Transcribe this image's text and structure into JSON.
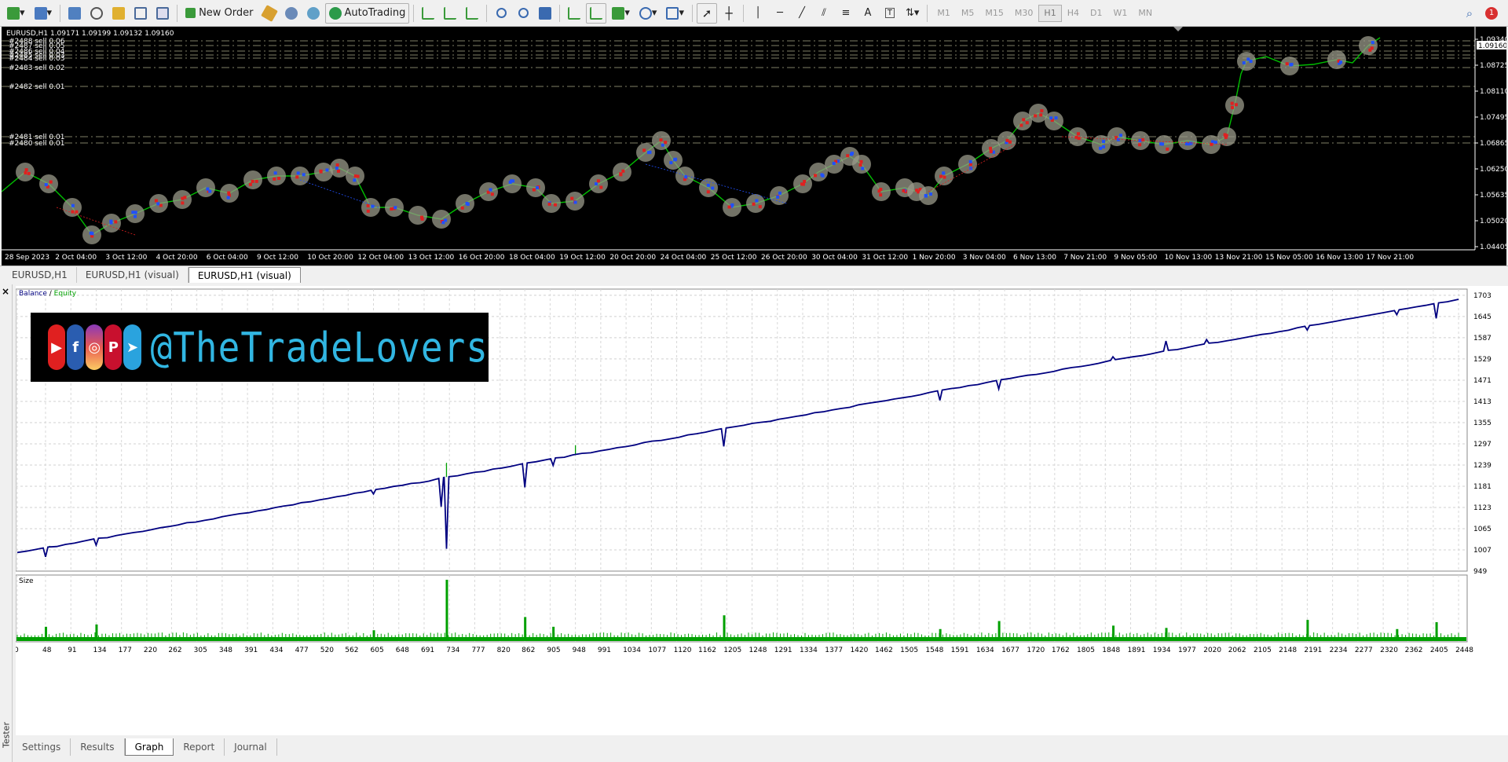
{
  "toolbar": {
    "new_order_label": "New Order",
    "autotrading_label": "AutoTrading",
    "timeframes": [
      "M1",
      "M5",
      "M15",
      "M30",
      "H1",
      "H4",
      "D1",
      "W1",
      "MN"
    ],
    "active_timeframe": "H1",
    "notification_count": "1"
  },
  "chart": {
    "header": "EURUSD,H1  1.09171 1.09199 1.09132 1.09160",
    "orders": [
      "#2488 sell 0.06",
      "#2487 sell 0.05",
      "#2486 sell 0.04",
      "#2485 sell 0.03",
      "#2484 sell 0.03",
      "#2483 sell 0.02",
      "#2482 sell 0.01",
      "#2481 sell 0.01",
      "#2480 sell 0.01"
    ],
    "prices": [
      "1.09340",
      "1.08725",
      "1.08110",
      "1.07495",
      "1.06865",
      "1.06250",
      "1.05635",
      "1.05020",
      "1.04405"
    ],
    "current_price": "1.09160",
    "dates": [
      "28 Sep 2023",
      "2 Oct 04:00",
      "3 Oct 12:00",
      "4 Oct 20:00",
      "6 Oct 04:00",
      "9 Oct 12:00",
      "10 Oct 20:00",
      "12 Oct 04:00",
      "13 Oct 12:00",
      "16 Oct 20:00",
      "18 Oct 04:00",
      "19 Oct 12:00",
      "20 Oct 20:00",
      "24 Oct 04:00",
      "25 Oct 12:00",
      "26 Oct 20:00",
      "30 Oct 04:00",
      "31 Oct 12:00",
      "1 Nov 20:00",
      "3 Nov 04:00",
      "6 Nov 13:00",
      "7 Nov 21:00",
      "9 Nov 05:00",
      "10 Nov 13:00",
      "13 Nov 21:00",
      "15 Nov 05:00",
      "16 Nov 13:00",
      "17 Nov 21:00"
    ],
    "colors": {
      "background": "#000000",
      "price": "#00c000",
      "buy": "#2050ff",
      "sell": "#e02020",
      "order_line": "#c8c8a0"
    }
  },
  "chart_tabs": [
    "EURUSD,H1",
    "EURUSD,H1 (visual)",
    "EURUSD,H1 (visual)"
  ],
  "tester": {
    "side_label": "Tester",
    "legend_balance": "Balance",
    "legend_sep": " / ",
    "legend_equity": "Equity",
    "size_label": "Size",
    "banner_handle": "@TheTradeLovers",
    "banner_icons": [
      "youtube-icon",
      "facebook-icon",
      "instagram-icon",
      "pinterest-icon",
      "telegram-icon"
    ],
    "tabs": [
      "Settings",
      "Results",
      "Graph",
      "Report",
      "Journal"
    ],
    "active_tab": "Graph"
  },
  "chart_data": {
    "type": "line",
    "title": "",
    "series": [
      {
        "name": "Balance",
        "color": "#000080"
      },
      {
        "name": "Equity",
        "color": "#00a000"
      }
    ],
    "x": [
      0,
      2448
    ],
    "balance_trend": [
      1000,
      1692
    ],
    "ylim": [
      949,
      1720
    ],
    "yticks": [
      1703,
      1645,
      1587,
      1529,
      1471,
      1413,
      1355,
      1297,
      1239,
      1181,
      1123,
      1065,
      1007,
      949
    ],
    "xticks": [
      0,
      48,
      91,
      134,
      177,
      220,
      262,
      305,
      348,
      391,
      434,
      477,
      520,
      562,
      605,
      648,
      691,
      734,
      777,
      820,
      862,
      905,
      948,
      991,
      1034,
      1077,
      1120,
      1162,
      1205,
      1248,
      1291,
      1334,
      1377,
      1420,
      1462,
      1505,
      1548,
      1591,
      1634,
      1677,
      1720,
      1762,
      1805,
      1848,
      1891,
      1934,
      1977,
      2020,
      2062,
      2105,
      2148,
      2191,
      2234,
      2277,
      2320,
      2362,
      2405,
      2448
    ],
    "drawdowns": [
      [
        48,
        988
      ],
      [
        134,
        1020
      ],
      [
        605,
        1160
      ],
      [
        720,
        1125
      ],
      [
        729,
        1010
      ],
      [
        862,
        1178
      ],
      [
        910,
        1238
      ],
      [
        1200,
        1290
      ],
      [
        1567,
        1416
      ],
      [
        1667,
        1447
      ],
      [
        1861,
        1535
      ],
      [
        1951,
        1578
      ],
      [
        2020,
        1582
      ],
      [
        2191,
        1608
      ],
      [
        2343,
        1650
      ],
      [
        2410,
        1640
      ]
    ],
    "size_spikes": [
      [
        48,
        0.18
      ],
      [
        134,
        0.22
      ],
      [
        605,
        0.12
      ],
      [
        729,
        1.0
      ],
      [
        862,
        0.35
      ],
      [
        910,
        0.18
      ],
      [
        1200,
        0.38
      ],
      [
        1567,
        0.14
      ],
      [
        1667,
        0.28
      ],
      [
        1861,
        0.2
      ],
      [
        1951,
        0.16
      ],
      [
        2191,
        0.3
      ],
      [
        2343,
        0.14
      ],
      [
        2410,
        0.26
      ]
    ]
  }
}
